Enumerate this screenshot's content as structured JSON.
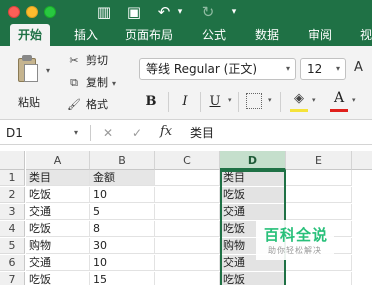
{
  "title_bar": {
    "toolbar_icons": [
      "sidebar-toggle-icon",
      "save-icon",
      "undo-icon",
      "redo-icon",
      "more-icon"
    ]
  },
  "ribbon_tabs": [
    {
      "label": "开始",
      "active": true
    },
    {
      "label": "插入"
    },
    {
      "label": "页面布局"
    },
    {
      "label": "公式"
    },
    {
      "label": "数据"
    },
    {
      "label": "审阅"
    },
    {
      "label": "视"
    }
  ],
  "clipboard": {
    "paste_label": "粘贴",
    "cut_label": "剪切",
    "copy_label": "复制",
    "format_label": "格式"
  },
  "font": {
    "family": "等线 Regular (正文)",
    "size": "12",
    "bold": "B",
    "italic": "I",
    "underline": "U",
    "font_color_glyph": "A",
    "fill_color": "#f5e33a",
    "font_color": "#e0201c"
  },
  "formula_bar": {
    "name_box": "D1",
    "cancel": "✕",
    "enter": "✓",
    "fx": "fx",
    "content": "类目"
  },
  "columns": [
    "A",
    "B",
    "C",
    "D",
    "E"
  ],
  "rows": [
    "1",
    "2",
    "3",
    "4",
    "5",
    "6",
    "7"
  ],
  "cells": {
    "A": [
      "类目",
      "吃饭",
      "交通",
      "吃饭",
      "购物",
      "交通",
      "吃饭"
    ],
    "B": [
      "金额",
      "10",
      "5",
      "8",
      "30",
      "10",
      "15"
    ],
    "D": [
      "类目",
      "吃饭",
      "交通",
      "吃饭",
      "购物",
      "交通",
      "吃饭"
    ]
  },
  "watermark": {
    "title": "百科全说",
    "subtitle": "助你轻松解决"
  },
  "colors": {
    "excel_green": "#1f7145",
    "selection_header": "#c5dfcc"
  }
}
